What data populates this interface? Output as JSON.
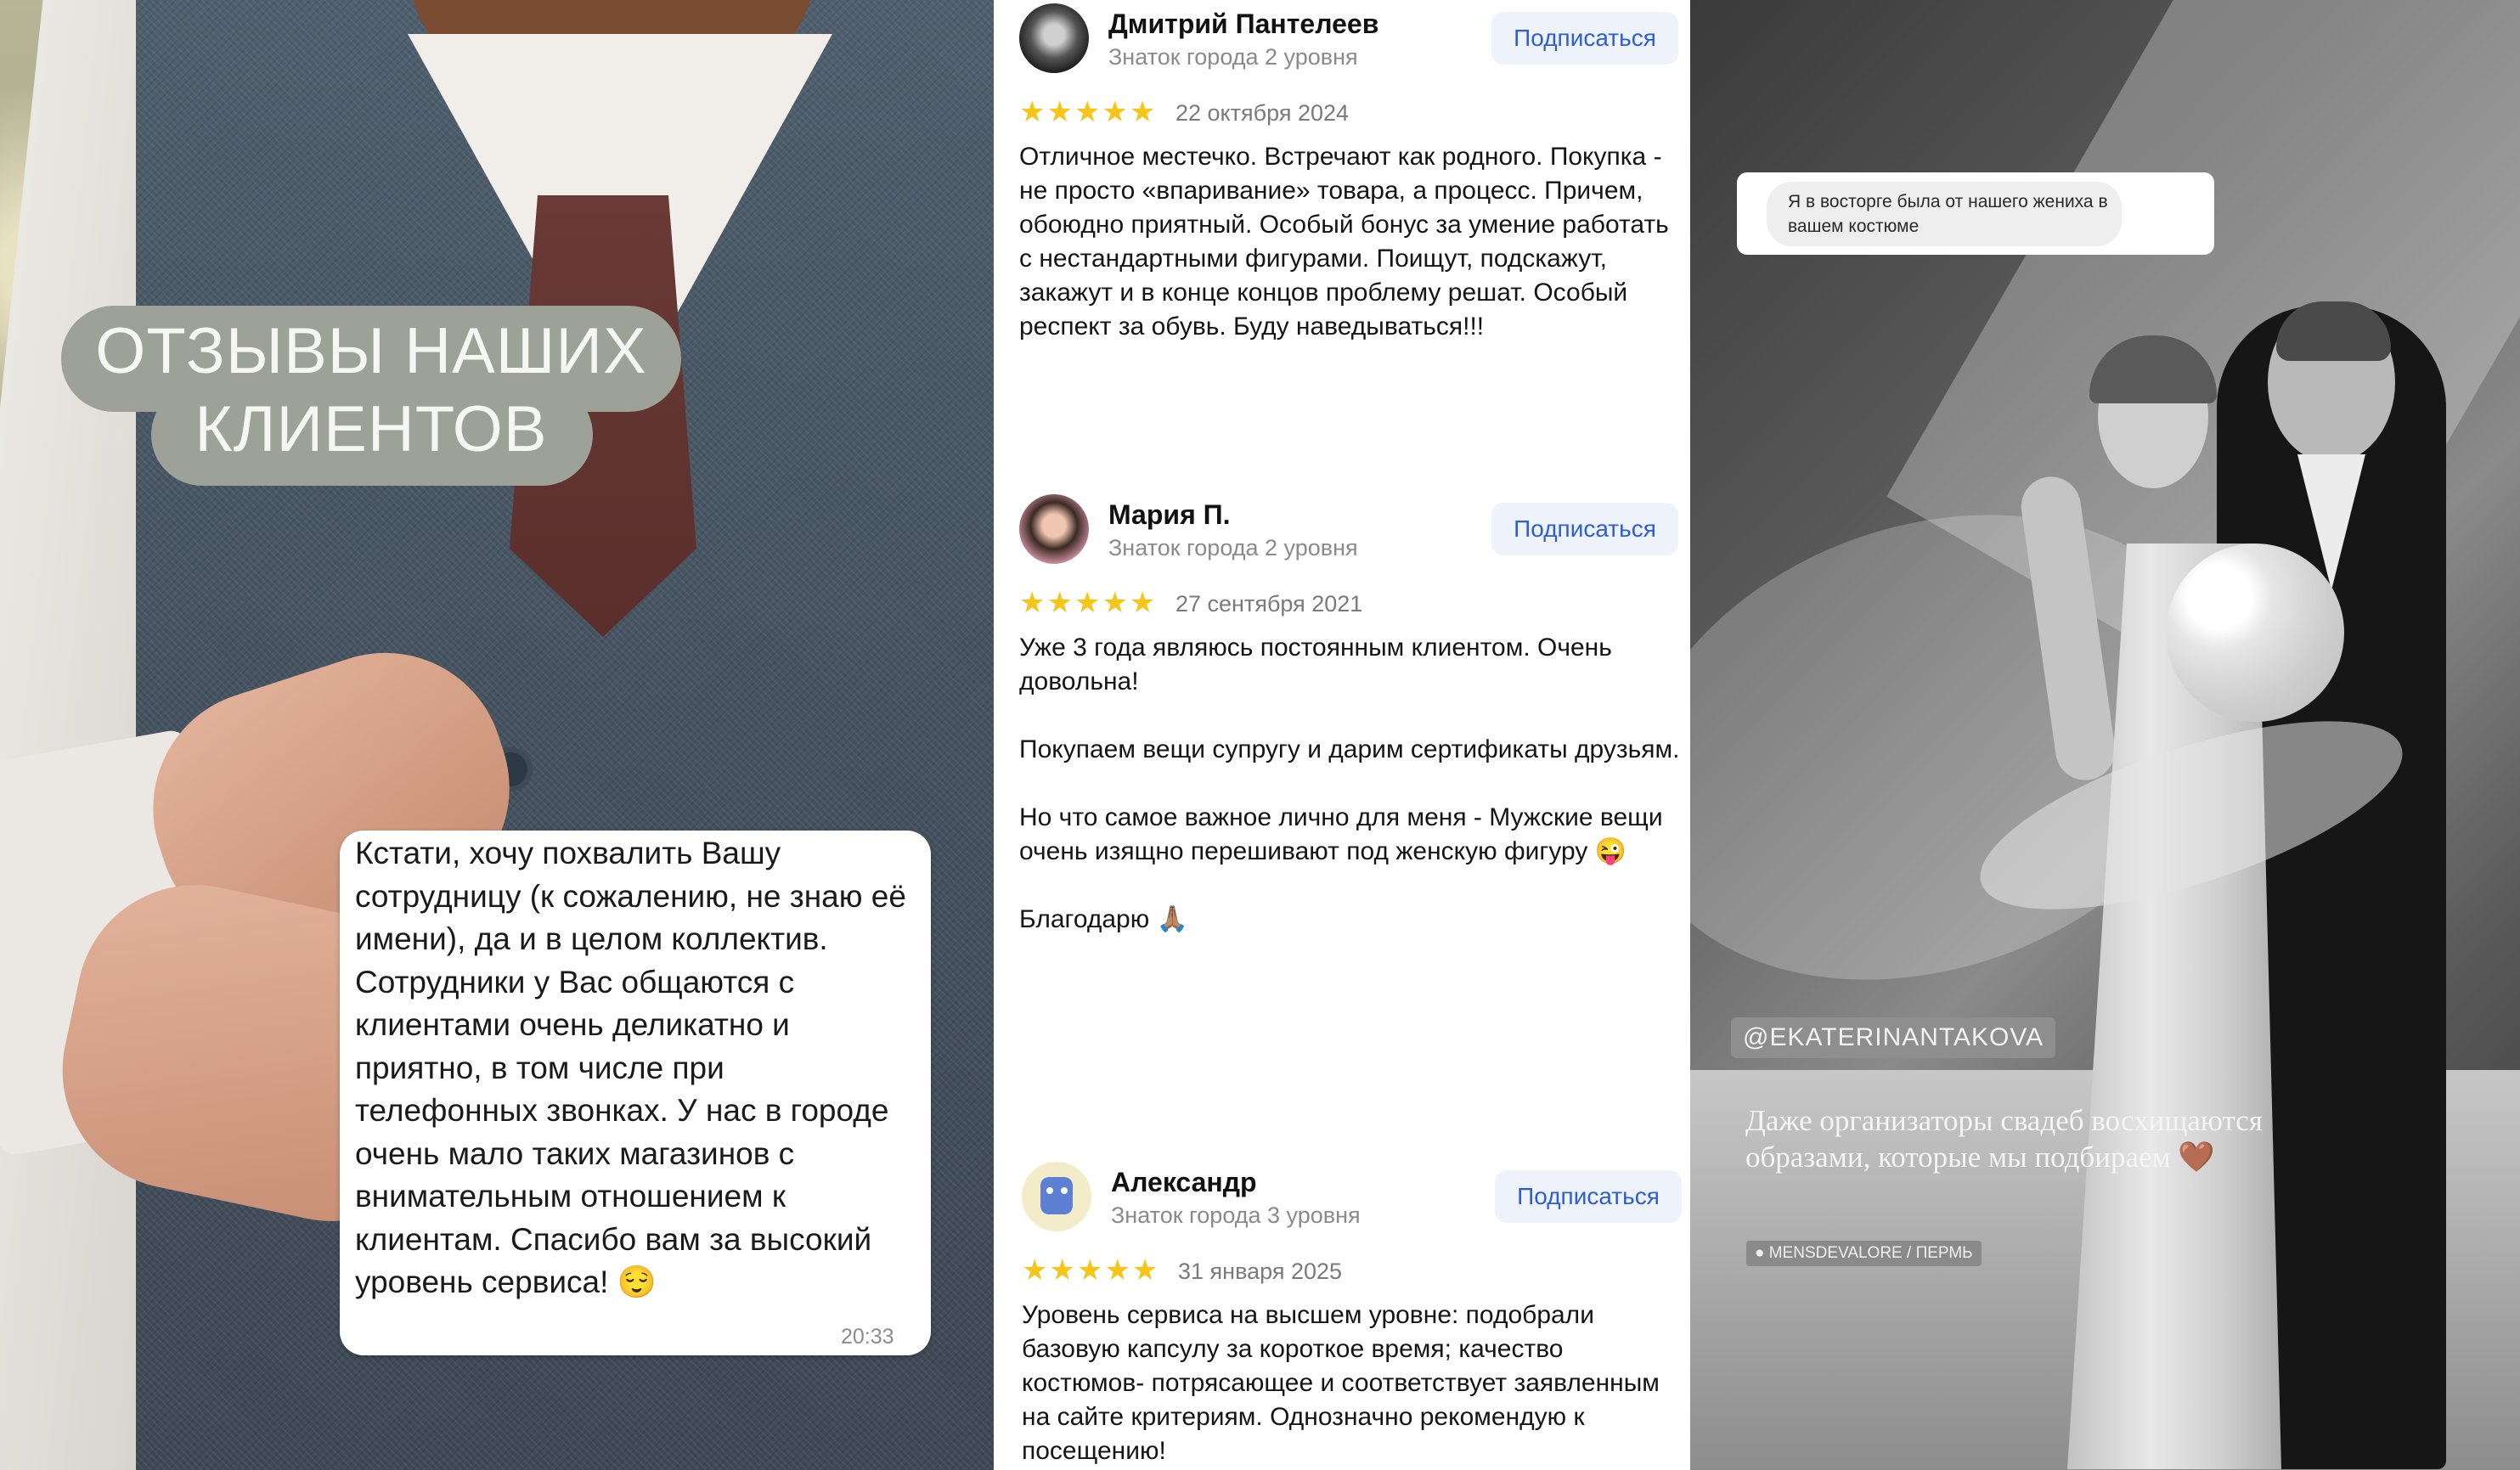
{
  "left_panel": {
    "title": "ОТЗЫВЫ НАШИХ\nКЛИЕНТОВ",
    "title_line1": "ОТЗЫВЫ НАШИХ",
    "title_line2": "КЛИЕНТОВ",
    "chat_message": "Кстати, хочу похвалить Вашу сотрудницу (к сожалению, не знаю её имени), да и в целом коллектив. Сотрудники у Вас общаются с клиентами очень деликатно и приятно, в том числе при телефонных звонках. У нас в городе очень мало таких магазинов с внимательным отношением к клиентам. Спасибо вам за высокий уровень сервиса! 😌",
    "chat_time": "20:33"
  },
  "reviews": [
    {
      "author": "Дмитрий Пантелеев",
      "level": "Знаток города 2 уровня",
      "subscribe_label": "Подписаться",
      "stars": "★★★★★",
      "rating": 5,
      "date": "22 октября 2024",
      "text": "Отличное местечко. Встречают как родного. Покупка - не просто «впаривание» товара, а процесс. Причем, обоюдно приятный. Особый бонус за умение работать с нестандартными фигурами. Поищут, подскажут, закажут и в конце концов проблему решат. Особый респект за обувь. Буду наведываться!!!"
    },
    {
      "author": "Мария П.",
      "level": "Знаток города 2 уровня",
      "subscribe_label": "Подписаться",
      "stars": "★★★★★",
      "rating": 5,
      "date": "27 сентября 2021",
      "text": "Уже 3 года являюсь постоянным клиентом. Очень довольна!\n\nПокупаем вещи супругу и дарим сертификаты друзьям.\n\nНо что самое важное лично для меня - Мужские вещи очень изящно перешивают под женскую фигуру 😜\n\nБлагодарю 🙏🏽"
    },
    {
      "author": "Александр",
      "level": "Знаток города 3 уровня",
      "subscribe_label": "Подписаться",
      "stars": "★★★★★",
      "rating": 5,
      "date": "31 января 2025",
      "text": "Уровень сервиса на высшем уровне: подобрали базовую капсулу за короткое время; качество костюмов- потрясающее и соответствует заявленным на сайте критериям. Однозначно рекомендую к посещению!"
    }
  ],
  "right_panel": {
    "quote": "Я в восторге была от нашего жениха в вашем костюме",
    "handle": "@EKATERINANTAKOVA",
    "caption": "Даже организаторы свадеб восхищаются образами, которые мы подбираем 🤎",
    "location_tag": "MENSDEVALORE / ПЕРМЬ"
  },
  "colors": {
    "accent_blue": "#2e5ed4",
    "star_yellow": "#f5c518",
    "title_pill": "#9ea198"
  }
}
